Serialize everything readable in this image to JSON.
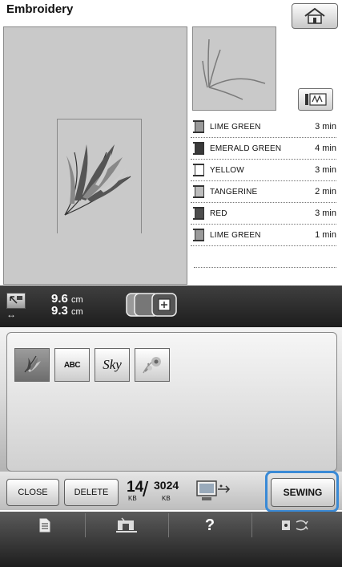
{
  "header": {
    "title": "Embroidery",
    "home_icon": "home-icon"
  },
  "thread_colors": [
    {
      "name": "LIME GREEN",
      "time": "3 min",
      "color": "#9a9a9a"
    },
    {
      "name": "EMERALD GREEN",
      "time": "4 min",
      "color": "#3a3a3a"
    },
    {
      "name": "YELLOW",
      "time": "3 min",
      "color": "#ffffff"
    },
    {
      "name": "TANGERINE",
      "time": "2 min",
      "color": "#bdbdbd"
    },
    {
      "name": "RED",
      "time": "3 min",
      "color": "#4d4d4d"
    },
    {
      "name": "LIME GREEN",
      "time": "1 min",
      "color": "#9a9a9a"
    }
  ],
  "size": {
    "height_value": "9.6",
    "width_value": "9.3",
    "unit": "cm"
  },
  "categories": {
    "abc_label": "ABC",
    "sky_label": "Sky",
    "items": [
      "embroidery-patterns-icon",
      "alphabet-fonts-icon",
      "sky-font-icon",
      "floral-alphabet-icon"
    ],
    "active_index": 0
  },
  "bottom": {
    "close_label": "CLOSE",
    "delete_label": "DELETE",
    "sewing_label": "SEWING",
    "memory_used": "14",
    "memory_total": "3024",
    "memory_unit": "KB"
  },
  "nav": {
    "help_label": "?",
    "items": [
      "page-icon",
      "sewing-machine-icon",
      "help-icon",
      "thread-swap-icon"
    ]
  },
  "accent_color": "#3a8ad6"
}
